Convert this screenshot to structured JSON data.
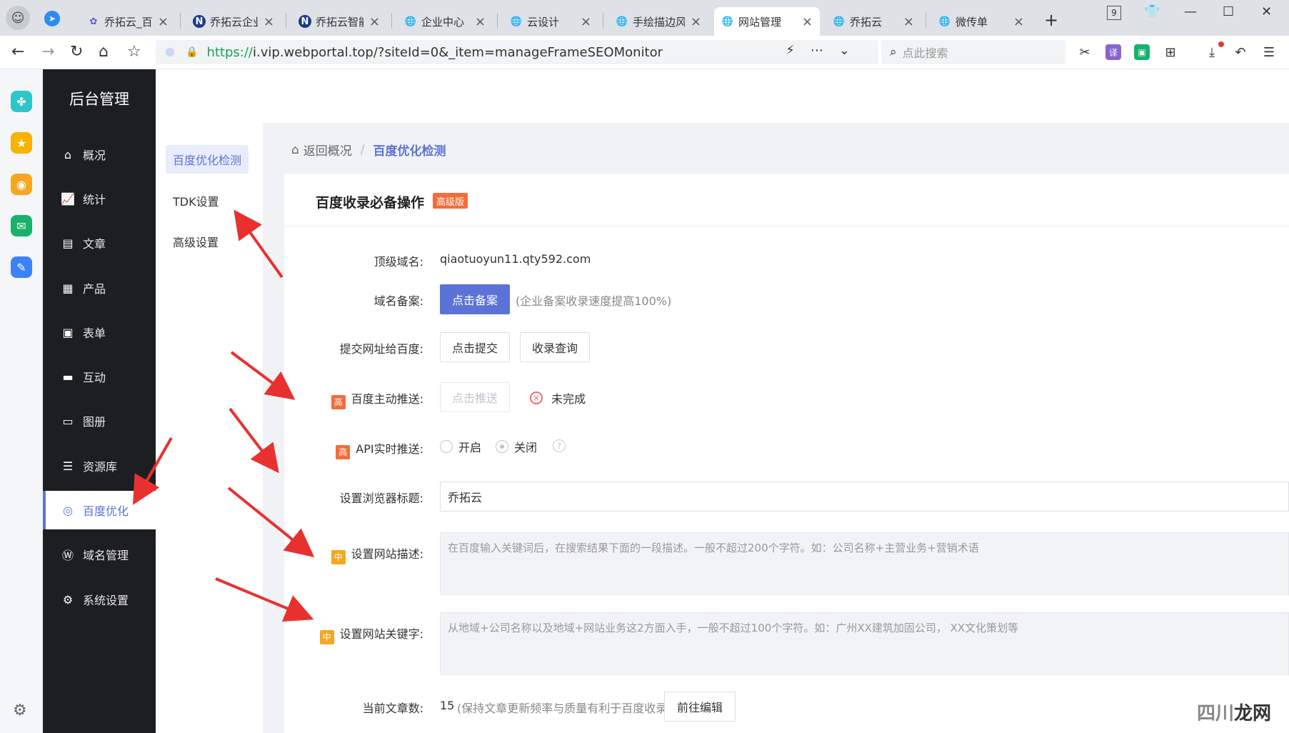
{
  "browser": {
    "tabs": [
      {
        "label": "乔拓云_百",
        "active": false
      },
      {
        "label": "乔拓云企业",
        "active": false
      },
      {
        "label": "乔拓云智能",
        "active": false
      },
      {
        "label": "企业中心",
        "active": false
      },
      {
        "label": "云设计",
        "active": false
      },
      {
        "label": "手绘描边风",
        "active": false
      },
      {
        "label": "网站管理",
        "active": true
      },
      {
        "label": "乔拓云",
        "active": false
      },
      {
        "label": "微传单",
        "active": false
      }
    ],
    "tab_counter": "9",
    "url_scheme": "https://",
    "url_rest": "i.vip.webportal.top/?siteId=0&_item=manageFrameSEOMonitor",
    "search_placeholder": "点此搜索",
    "ext_translate": "译"
  },
  "sidebar": {
    "title": "后台管理",
    "items": [
      {
        "label": "概况",
        "icon": "home-icon"
      },
      {
        "label": "统计",
        "icon": "chart-icon"
      },
      {
        "label": "文章",
        "icon": "article-icon"
      },
      {
        "label": "产品",
        "icon": "grid-icon"
      },
      {
        "label": "表单",
        "icon": "calendar-icon"
      },
      {
        "label": "互动",
        "icon": "chat-icon"
      },
      {
        "label": "图册",
        "icon": "album-icon"
      },
      {
        "label": "资源库",
        "icon": "database-icon"
      },
      {
        "label": "百度优化",
        "icon": "spiral-icon",
        "active": true
      },
      {
        "label": "域名管理",
        "icon": "w-icon"
      },
      {
        "label": "系统设置",
        "icon": "gear-icon"
      }
    ]
  },
  "submenu": {
    "items": [
      {
        "label": "百度优化检测",
        "active": true
      },
      {
        "label": "TDK设置"
      },
      {
        "label": "高级设置"
      }
    ]
  },
  "breadcrumb": {
    "back": "返回概况",
    "separator": "/",
    "current": "百度优化检测"
  },
  "card": {
    "title": "百度收录必备操作",
    "badge": "高级版"
  },
  "form": {
    "domain_label": "顶级域名:",
    "domain_value": "qiaotuoyun11.qty592.com",
    "icp_label": "域名备案:",
    "icp_button": "点击备案",
    "icp_hint": "(企业备案收录速度提高100%)",
    "submit_label": "提交网址给百度:",
    "submit_button": "点击提交",
    "query_button": "收录查询",
    "push_tag": "高",
    "push_label": "百度主动推送:",
    "push_button": "点击推送",
    "push_status": "未完成",
    "api_tag": "高",
    "api_label": "API实时推送:",
    "api_on": "开启",
    "api_off": "关闭",
    "help": "?",
    "title_label": "设置浏览器标题:",
    "title_value": "乔拓云",
    "desc_tag": "中",
    "desc_label": "设置网站描述:",
    "desc_placeholder": "在百度输入关键词后，在搜索结果下面的一段描述。一般不超过200个字符。如：公司名称+主营业务+营销术语",
    "kw_tag": "中",
    "kw_label": "设置网站关键字:",
    "kw_placeholder": "从地域+公司名称以及地域+网站业务这2方面入手，一般不超过100个字符。如：广州XX建筑加固公司， XX文化策划等",
    "count_label": "当前文章数:",
    "count_value": "15",
    "count_hint": "(保持文章更新频率与质量有利于百度收录)",
    "edit_button": "前往编辑"
  },
  "watermark": {
    "a": "四川",
    "b": "龙网"
  },
  "colors": {
    "accent": "#5b73d6",
    "high": "#f56c3a",
    "mid": "#f5a623",
    "arrow": "#e8312f",
    "sidebar": "#1d1e22"
  }
}
